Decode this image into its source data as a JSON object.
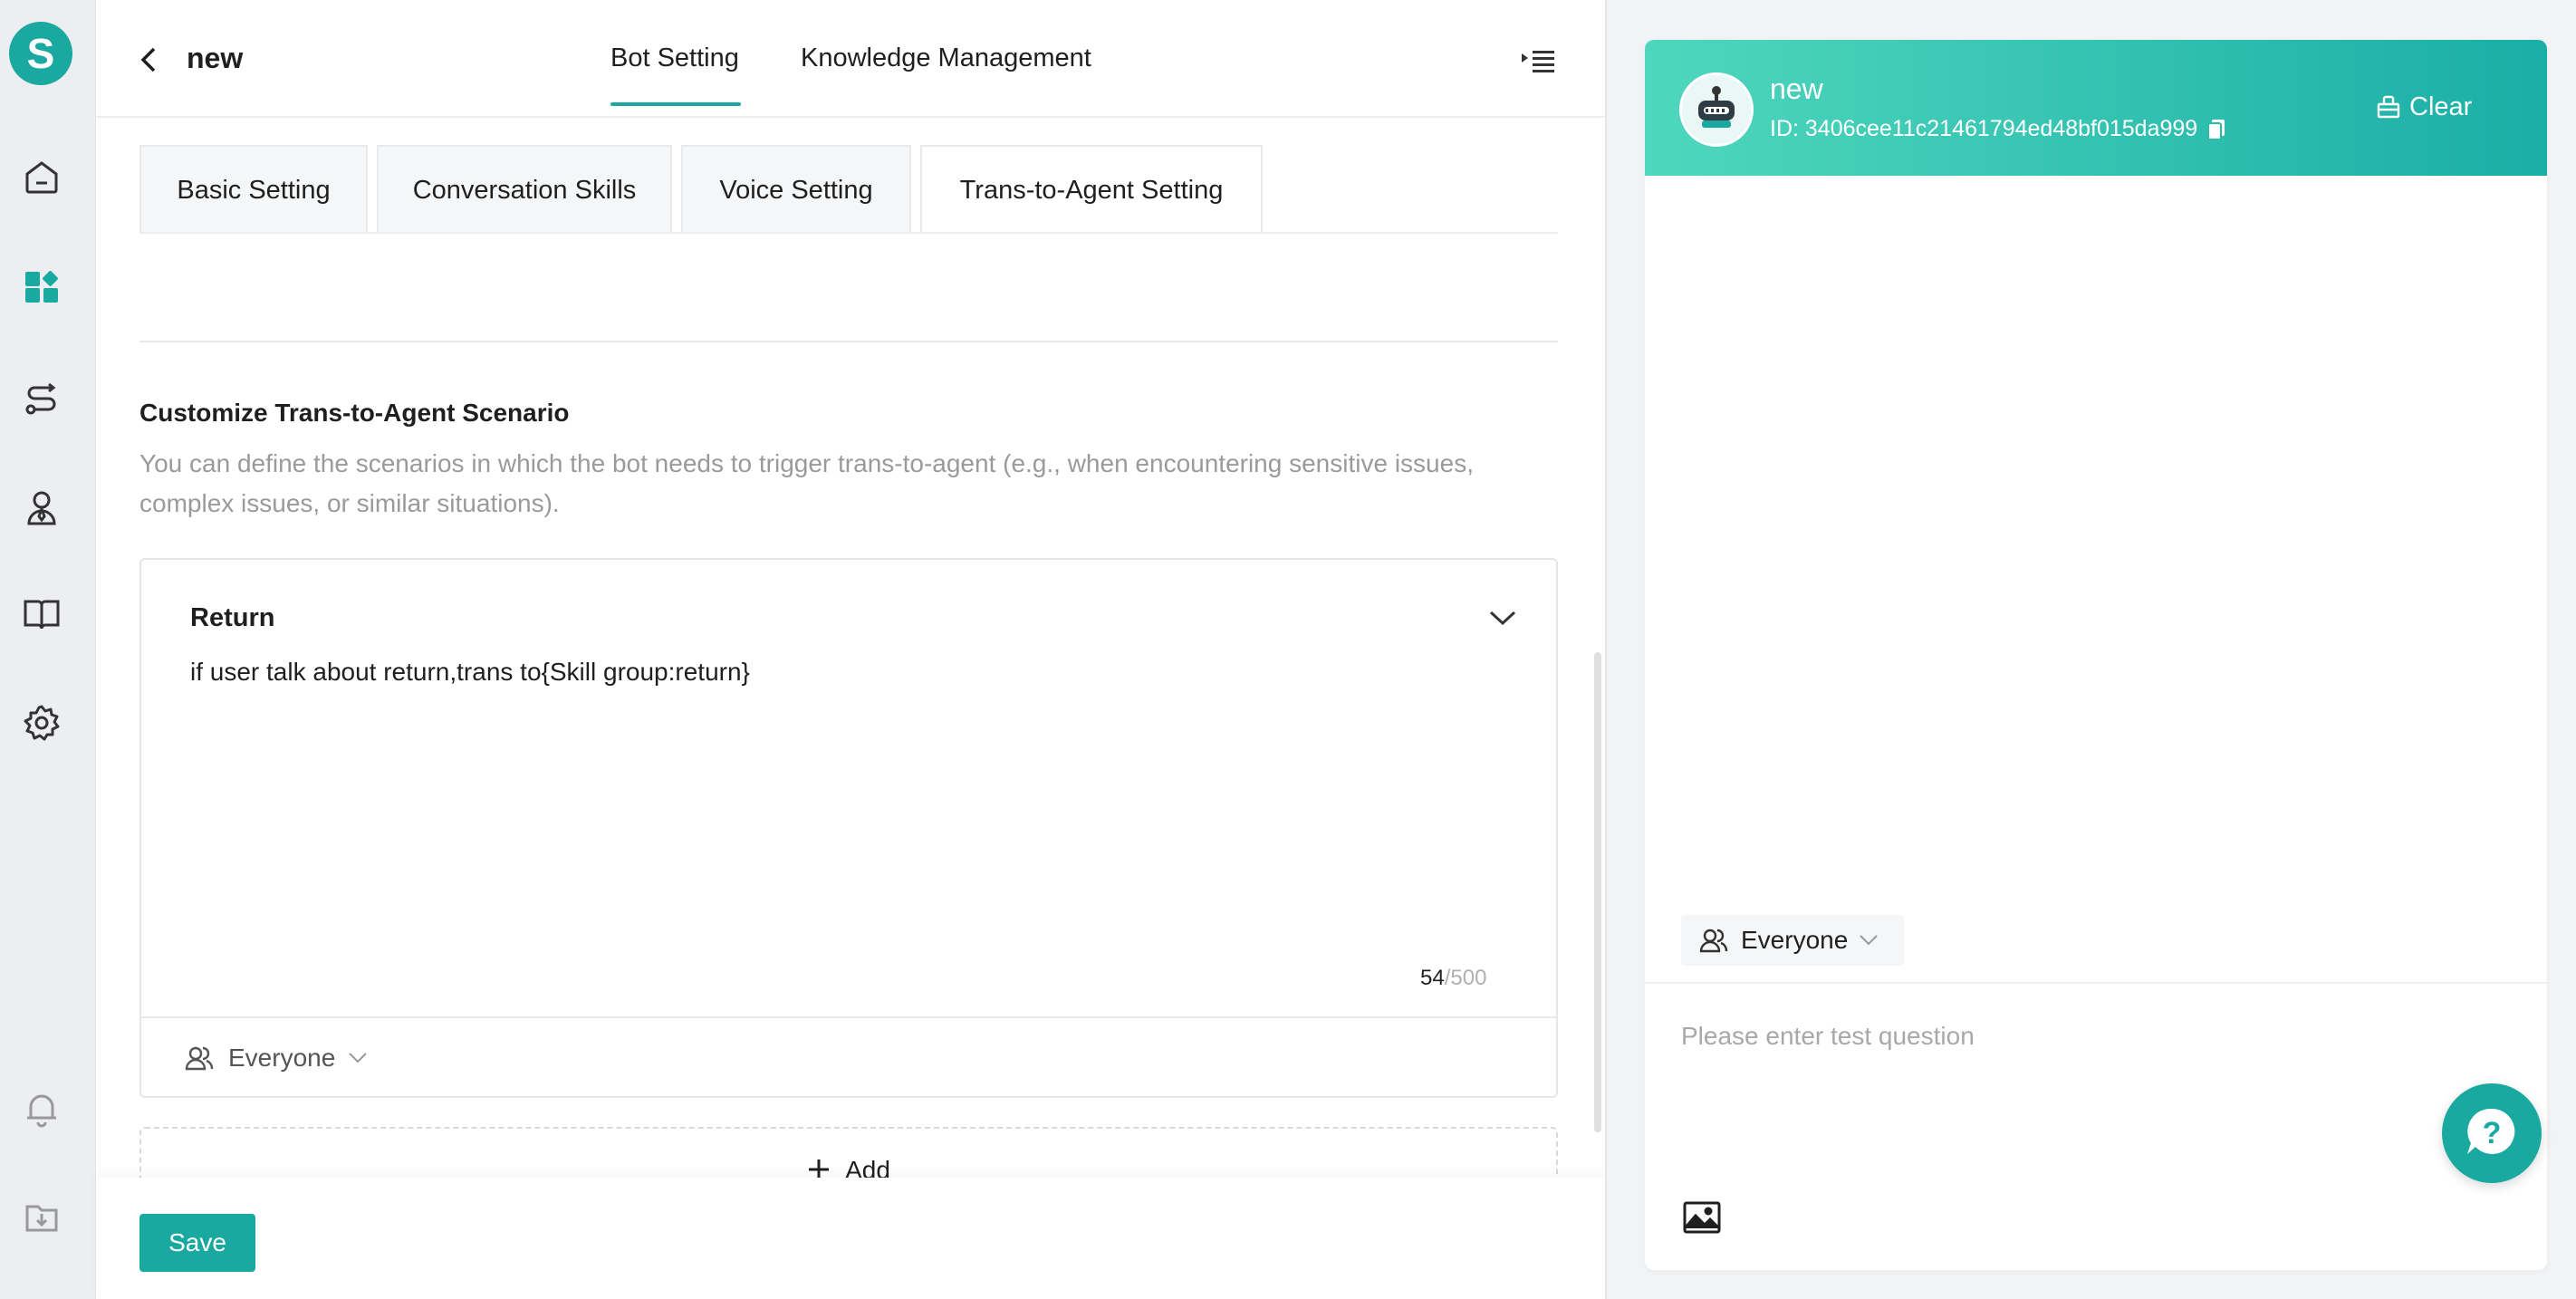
{
  "app": {
    "logo_letter": "S"
  },
  "nav": {
    "items": [
      {
        "icon": "home-icon"
      },
      {
        "icon": "dashboard-icon"
      },
      {
        "icon": "flow-icon"
      },
      {
        "icon": "agent-icon"
      },
      {
        "icon": "book-icon"
      },
      {
        "icon": "gear-icon"
      },
      {
        "icon": "bell-icon"
      },
      {
        "icon": "download-icon"
      }
    ]
  },
  "header": {
    "title": "new",
    "tabs": [
      {
        "label": "Bot Setting",
        "active": true
      },
      {
        "label": "Knowledge Management",
        "active": false
      }
    ]
  },
  "subtabs": [
    {
      "label": "Basic Setting",
      "active": false
    },
    {
      "label": "Conversation Skills",
      "active": false
    },
    {
      "label": "Voice Setting",
      "active": false
    },
    {
      "label": "Trans-to-Agent Setting",
      "active": true
    }
  ],
  "section": {
    "title": "Customize Trans-to-Agent Scenario",
    "description": "You can define the scenarios in which the bot needs to trigger trans-to-agent (e.g., when encountering sensitive issues, complex issues, or similar situations)."
  },
  "scenario": {
    "title": "Return",
    "text": "if user talk about return,trans to{Skill group:return}",
    "char_count": "54",
    "char_limit": "/500",
    "audience": "Everyone"
  },
  "actions": {
    "add_label": "Add",
    "save_label": "Save"
  },
  "test_panel": {
    "bot_name": "new",
    "bot_id": "ID: 3406cee11c21461794ed48bf015da999",
    "clear_label": "Clear",
    "audience": "Everyone",
    "input_placeholder": "Please enter test question"
  },
  "colors": {
    "accent": "#1aa9a0",
    "header_gradient_start": "#4fd7bd",
    "header_gradient_end": "#1aaea6"
  }
}
